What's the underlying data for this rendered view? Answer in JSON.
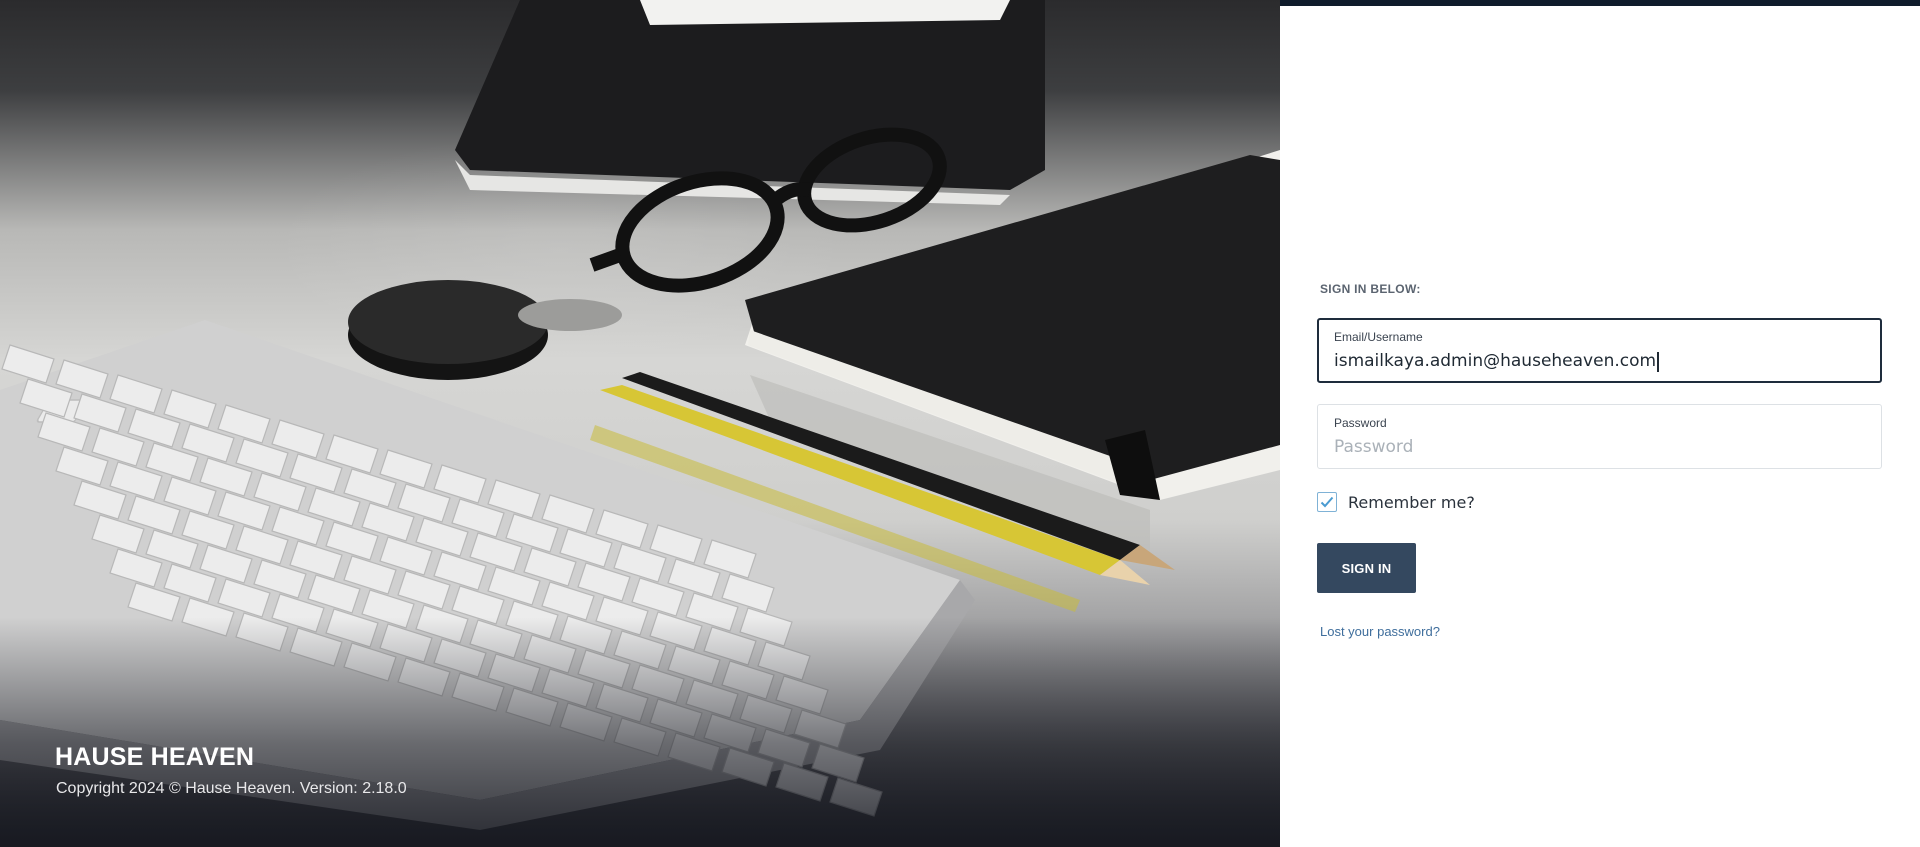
{
  "hero": {
    "brand": "HAUSE HEAVEN",
    "copyright": "Copyright 2024 © Hause Heaven. Version: 2.18.0"
  },
  "form": {
    "heading": "SIGN IN BELOW:",
    "email": {
      "label": "Email/Username",
      "value": "ismailkaya.admin@hauseheaven.com",
      "placeholder": "Email/Username"
    },
    "password": {
      "label": "Password",
      "value": "",
      "placeholder": "Password"
    },
    "remember": {
      "label": "Remember me?",
      "checked": true
    },
    "submit_label": "SIGN IN",
    "lost_password": "Lost your password?"
  },
  "colors": {
    "accent": "#34485f",
    "topbar": "#0f1c2b",
    "link": "#3f6e9c",
    "checkbox": "#4a9bd1"
  },
  "icons": {
    "checkbox": "checkmark-icon"
  }
}
